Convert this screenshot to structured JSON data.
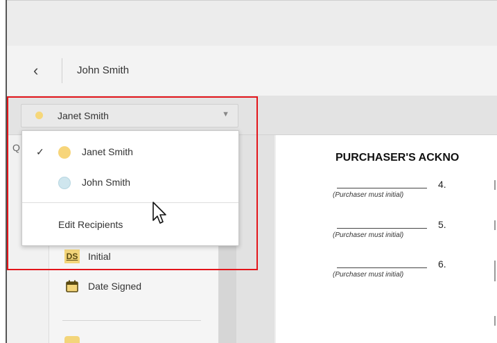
{
  "header": {
    "back_icon": "chevron-left-icon",
    "title": "John Smith"
  },
  "recipient_select": {
    "selected": "Janet Smith",
    "selected_color": "#f6d77a"
  },
  "dropdown": {
    "options": [
      {
        "label": "Janet Smith",
        "color": "#f7d57a",
        "checked": true
      },
      {
        "label": "John Smith",
        "color": "#cfe6ee",
        "checked": false
      }
    ],
    "edit_label": "Edit Recipients"
  },
  "tools": {
    "items": [
      {
        "icon": "DS",
        "label": "Initial"
      },
      {
        "icon": "calendar-icon",
        "label": "Date Signed"
      }
    ]
  },
  "document": {
    "title": "PURCHASER'S ACKNO",
    "rows": [
      {
        "number": "4.",
        "instruction": "(Purchaser must initial)"
      },
      {
        "number": "5.",
        "instruction": "(Purchaser must initial)"
      },
      {
        "number": "6.",
        "instruction": "(Purchaser must initial)"
      }
    ]
  },
  "colors": {
    "highlight": "#e3141a",
    "accent": "#f3d57a"
  }
}
